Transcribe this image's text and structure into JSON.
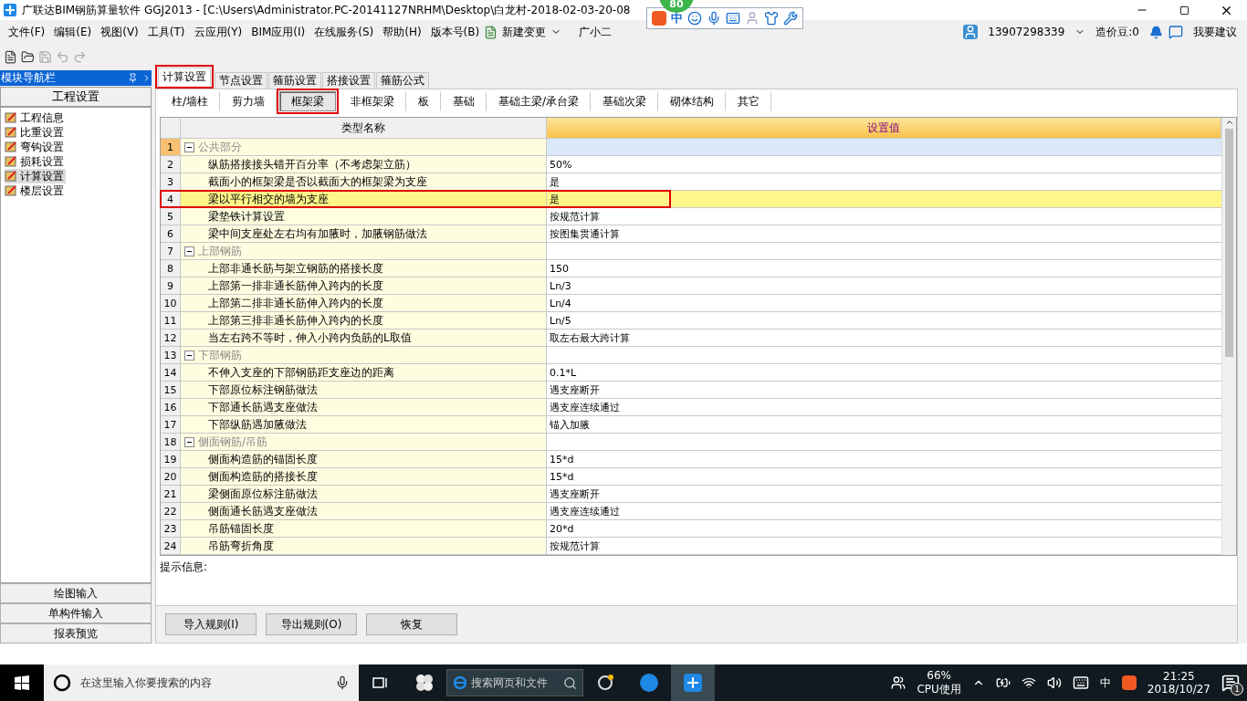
{
  "window": {
    "title": "广联达BIM钢筋算量软件 GGJ2013 - [C:\\Users\\Administrator.PC-20141127NRHM\\Desktop\\白龙村-2018-02-03-20-08"
  },
  "ime_bar": {
    "badge": "80",
    "mode": "中"
  },
  "menu": [
    "文件(F)",
    "编辑(E)",
    "视图(V)",
    "工具(T)",
    "云应用(Y)",
    "BIM应用(I)",
    "在线服务(S)",
    "帮助(H)",
    "版本号(B)"
  ],
  "new_change": "新建变更",
  "assistant": "广小二",
  "account": {
    "phone": "13907298339",
    "beans": "造价豆:0",
    "suggest": "我要建议"
  },
  "sidebar": {
    "title": "模块导航栏",
    "section": "工程设置",
    "items": [
      {
        "label": "工程信息",
        "selected": false
      },
      {
        "label": "比重设置",
        "selected": false
      },
      {
        "label": "弯钩设置",
        "selected": false
      },
      {
        "label": "损耗设置",
        "selected": false
      },
      {
        "label": "计算设置",
        "selected": true
      },
      {
        "label": "楼层设置",
        "selected": false
      }
    ],
    "bottom": [
      "绘图输入",
      "单构件输入",
      "报表预览"
    ]
  },
  "tabs": [
    {
      "label": "计算设置",
      "selected": true,
      "highlighted": true
    },
    {
      "label": "节点设置",
      "selected": false
    },
    {
      "label": "箍筋设置",
      "selected": false
    },
    {
      "label": "搭接设置",
      "selected": false
    },
    {
      "label": "箍筋公式",
      "selected": false
    }
  ],
  "subtabs": [
    {
      "label": "柱/墙柱",
      "selected": false
    },
    {
      "label": "剪力墙",
      "selected": false
    },
    {
      "label": "框架梁",
      "selected": true,
      "highlighted": true
    },
    {
      "label": "非框架梁",
      "selected": false
    },
    {
      "label": "板",
      "selected": false
    },
    {
      "label": "基础",
      "selected": false
    },
    {
      "label": "基础主梁/承台梁",
      "selected": false
    },
    {
      "label": "基础次梁",
      "selected": false
    },
    {
      "label": "砌体结构",
      "selected": false
    },
    {
      "label": "其它",
      "selected": false
    }
  ],
  "table": {
    "columns": [
      "类型名称",
      "设置值"
    ],
    "groups": [
      {
        "number": "1",
        "label": "公共部分",
        "expanded": true,
        "current": true,
        "children": [
          {
            "number": "2",
            "label": "纵筋搭接接头错开百分率（不考虑架立筋）",
            "value": "50%",
            "selected": false
          },
          {
            "number": "3",
            "label": "截面小的框架梁是否以截面大的框架梁为支座",
            "value": "是",
            "selected": false
          },
          {
            "number": "4",
            "label": "梁以平行相交的墙为支座",
            "value": "是",
            "selected": true,
            "highlighted": true
          },
          {
            "number": "5",
            "label": "梁垫铁计算设置",
            "value": "按规范计算",
            "selected": false
          },
          {
            "number": "6",
            "label": "梁中间支座处左右均有加腋时，加腋钢筋做法",
            "value": "按图集贯通计算",
            "selected": false
          }
        ]
      },
      {
        "number": "7",
        "label": "上部钢筋",
        "expanded": true,
        "current": false,
        "children": [
          {
            "number": "8",
            "label": "上部非通长筋与架立钢筋的搭接长度",
            "value": "150",
            "selected": false
          },
          {
            "number": "9",
            "label": "上部第一排非通长筋伸入跨内的长度",
            "value": "Ln/3",
            "selected": false
          },
          {
            "number": "10",
            "label": "上部第二排非通长筋伸入跨内的长度",
            "value": "Ln/4",
            "selected": false
          },
          {
            "number": "11",
            "label": "上部第三排非通长筋伸入跨内的长度",
            "value": "Ln/5",
            "selected": false
          },
          {
            "number": "12",
            "label": "当左右跨不等时，伸入小跨内负筋的L取值",
            "value": "取左右最大跨计算",
            "selected": false
          }
        ]
      },
      {
        "number": "13",
        "label": "下部钢筋",
        "expanded": true,
        "current": false,
        "children": [
          {
            "number": "14",
            "label": "不伸入支座的下部钢筋距支座边的距离",
            "value": "0.1*L",
            "selected": false
          },
          {
            "number": "15",
            "label": "下部原位标注钢筋做法",
            "value": "遇支座断开",
            "selected": false
          },
          {
            "number": "16",
            "label": "下部通长筋遇支座做法",
            "value": "遇支座连续通过",
            "selected": false
          },
          {
            "number": "17",
            "label": "下部纵筋遇加腋做法",
            "value": "锚入加腋",
            "selected": false
          }
        ]
      },
      {
        "number": "18",
        "label": "侧面钢筋/吊筋",
        "expanded": true,
        "current": false,
        "children": [
          {
            "number": "19",
            "label": "侧面构造筋的锚固长度",
            "value": "15*d",
            "selected": false
          },
          {
            "number": "20",
            "label": "侧面构造筋的搭接长度",
            "value": "15*d",
            "selected": false
          },
          {
            "number": "21",
            "label": "梁侧面原位标注筋做法",
            "value": "遇支座断开",
            "selected": false
          },
          {
            "number": "22",
            "label": "侧面通长筋遇支座做法",
            "value": "遇支座连续通过",
            "selected": false
          },
          {
            "number": "23",
            "label": "吊筋锚固长度",
            "value": "20*d",
            "selected": false
          },
          {
            "number": "24",
            "label": "吊筋弯折角度",
            "value": "按规范计算",
            "selected": false
          }
        ]
      }
    ]
  },
  "hint_label": "提示信息:",
  "buttons": [
    "导入规则(I)",
    "导出规则(O)",
    "恢复"
  ],
  "taskbar": {
    "search_placeholder": "在这里输入你要搜索的内容",
    "web_search": "搜索网页和文件",
    "cpu_percent": "66%",
    "cpu_label": "CPU使用",
    "ime": "中",
    "time": "21:25",
    "date": "2018/10/27",
    "notifications": "1"
  }
}
